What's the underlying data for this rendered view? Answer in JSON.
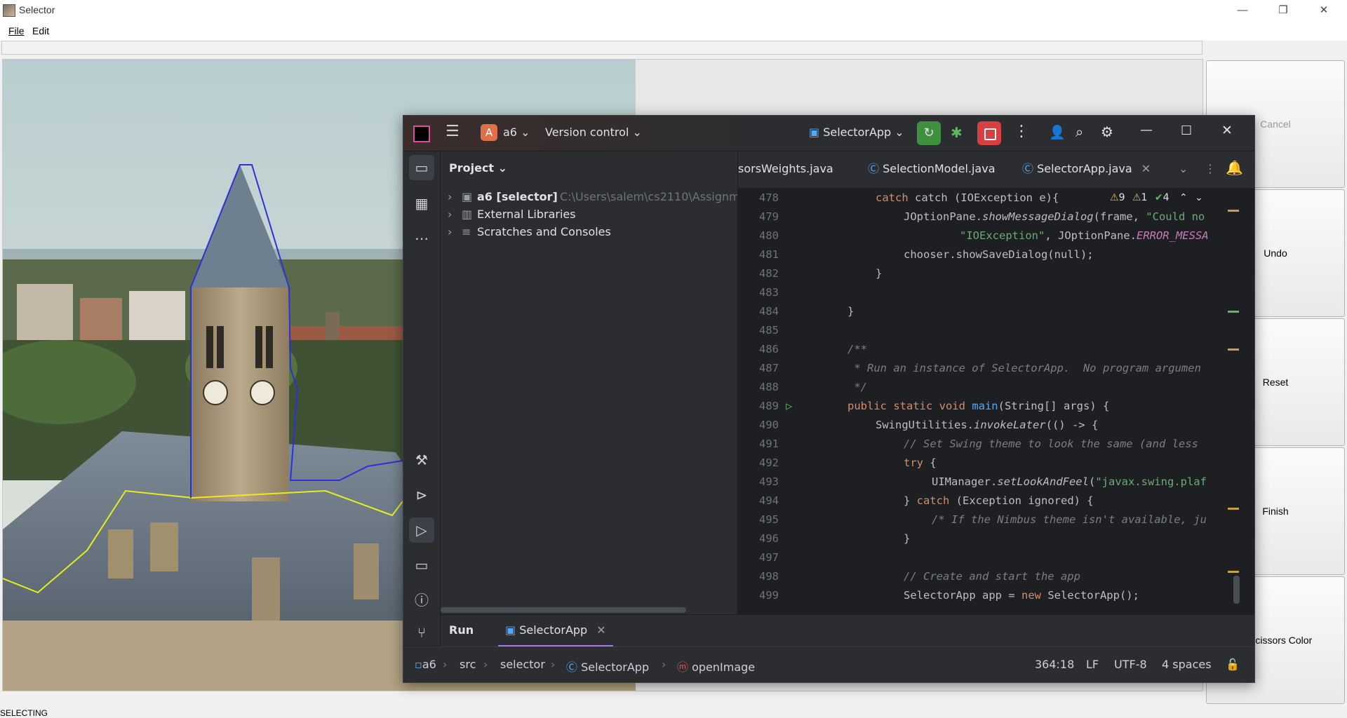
{
  "window": {
    "title": "Selector",
    "minimize": "—",
    "restore": "❐",
    "close": "✕"
  },
  "menu": {
    "file": "File",
    "edit": "Edit"
  },
  "side_buttons": {
    "cancel": "Cancel",
    "undo": "Undo",
    "reset": "Reset",
    "finish": "Finish",
    "scissors_color": "Scissors Color"
  },
  "status": "SELECTING",
  "ide": {
    "project_letter": "A",
    "project_name": "a6",
    "version_control": "Version control",
    "run_config": "SelectorApp",
    "project_label": "Project",
    "tree": [
      {
        "name": "a6 [selector]",
        "path": "C:\\Users\\salem\\cs2110\\Assignm"
      },
      {
        "name": "External Libraries",
        "path": ""
      },
      {
        "name": "Scratches and Consoles",
        "path": ""
      }
    ],
    "tabs": [
      "sorsWeights.java",
      "SelectionModel.java",
      "SelectorApp.java"
    ],
    "inspections": {
      "warnings": "9",
      "weak_warnings": "1",
      "typos": "4"
    },
    "run_label": "Run",
    "run_tab": "SelectorApp",
    "breadcrumbs": [
      "a6",
      "src",
      "selector",
      "SelectorApp",
      "openImage"
    ],
    "status": {
      "position": "364:18",
      "line_sep": "LF",
      "encoding": "UTF-8",
      "indent": "4 spaces"
    },
    "code_lines": [
      {
        "n": "478"
      },
      {
        "n": "479"
      },
      {
        "n": "480"
      },
      {
        "n": "481"
      },
      {
        "n": "482"
      },
      {
        "n": "483"
      },
      {
        "n": "484"
      },
      {
        "n": "485"
      },
      {
        "n": "486"
      },
      {
        "n": "487"
      },
      {
        "n": "488"
      },
      {
        "n": "489"
      },
      {
        "n": "490"
      },
      {
        "n": "491"
      },
      {
        "n": "492"
      },
      {
        "n": "493"
      },
      {
        "n": "494"
      },
      {
        "n": "495"
      },
      {
        "n": "496"
      },
      {
        "n": "497"
      },
      {
        "n": "498"
      },
      {
        "n": "499"
      }
    ],
    "code_text": {
      "l478": "catch (IOException e){",
      "l479a": "JOptionPane.",
      "l479b": "showMessageDialog",
      "l479c": "(frame, ",
      "l479d": "\"Could no",
      "l480a": "\"IOException\"",
      "l480b": ", JOptionPane.",
      "l480c": "ERROR_MESSA",
      "l481": "chooser.showSaveDialog(null);",
      "l482": "}",
      "l484": "}",
      "l486": "/**",
      "l487": " * Run an instance of SelectorApp.  No program argumen",
      "l488": " */",
      "l489a": "public static void ",
      "l489b": "main",
      "l489c": "(String[] args) {",
      "l490a": "SwingUtilities.",
      "l490b": "invokeLater",
      "l490c": "(() -> {",
      "l491": "// Set Swing theme to look the same (and less",
      "l492a": "try",
      "l492b": " {",
      "l493a": "UIManager.",
      "l493b": "setLookAndFeel",
      "l493c": "(",
      "l493d": "\"javax.swing.plaf",
      "l494a": "} ",
      "l494b": "catch",
      "l494c": " (Exception ignored) {",
      "l495": "/* If the Nimbus theme isn't available, ju",
      "l496": "}",
      "l498": "// Create and start the app",
      "l499a": "SelectorApp app = ",
      "l499b": "new",
      "l499c": " SelectorApp();"
    }
  }
}
